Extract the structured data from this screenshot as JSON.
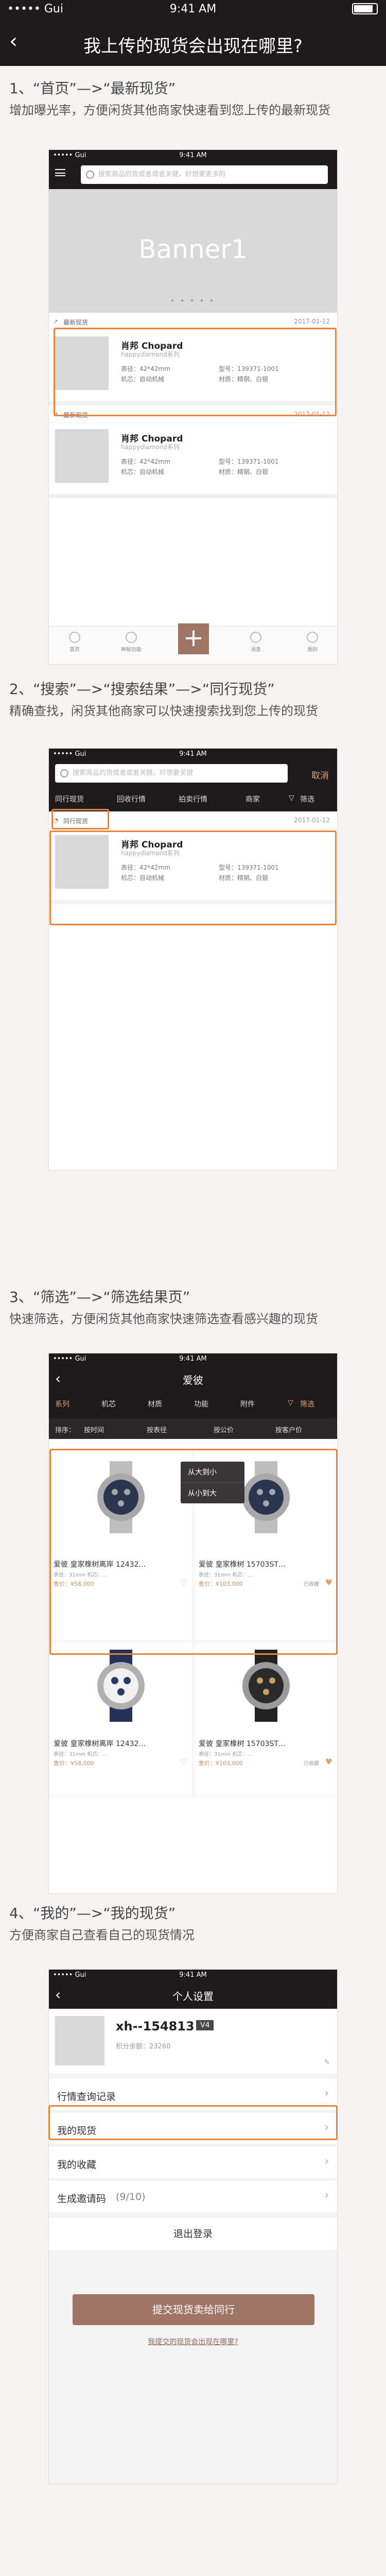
{
  "status_bar": {
    "carrier": "••••• Gui",
    "wifi": "wifi-icon",
    "time": "9:41 AM",
    "battery": "battery-icon"
  },
  "header": {
    "back": "‹",
    "title": "我上传的现货会出现在哪里?"
  },
  "sections": [
    {
      "title": "1、“首页”—>“最新现货”",
      "desc": "增加曝光率，方便闲货其他商家快速看到您上传的最新现货"
    },
    {
      "title": "2、“搜索”—>“搜索结果”—>“同行现货”",
      "desc": "精确查找，闲货其他商家可以快速搜索找到您上传的现货"
    },
    {
      "title": "3、“筛选”—>“筛选结果页”",
      "desc": "快速筛选，方便闲货其他商家快速筛选查看感兴趣的现货"
    },
    {
      "title": "4、“我的”—>“我的现货”",
      "desc": "方便商家自己查看自己的现货情况"
    }
  ],
  "mock_status": {
    "carrier": "••••• Gui",
    "time": "9:41 AM"
  },
  "home": {
    "search_placeholder": "搜索商品的货或者或者关键，好想要更多的",
    "banner": "Banner1",
    "dots": "• • • • •",
    "cards": [
      {
        "label": "最新现货",
        "date": "2017-01-12",
        "brand": "肖邦 Chopard",
        "series": "happydiamond系列",
        "spec1": "表径：42*42mm",
        "spec2": "型号：139371-1001",
        "spec3": "机芯：自动机械",
        "spec4": "材质：精钢、白银"
      },
      {
        "label": "最新现货",
        "date": "2017-01-12",
        "brand": "肖邦 Chopard",
        "series": "happydiamond系列",
        "spec1": "表径：42*42mm",
        "spec2": "型号：139371-1001",
        "spec3": "机芯：自动机械",
        "spec4": "材质：精钢、白银"
      }
    ],
    "tabs": [
      "首页",
      "神秘功能",
      "消息",
      "我的"
    ],
    "plus": "+"
  },
  "search": {
    "placeholder": "搜索商品的货或者或者关键，好想要关键",
    "cancel": "取消",
    "tabs": [
      "同行现货",
      "回收行情",
      "拍卖行情",
      "商家"
    ],
    "filter": "筛选",
    "card": {
      "label": "同行现货",
      "date": "2017-01-12",
      "brand": "肖邦 Chopard",
      "series": "happydiamond系列",
      "spec1": "表径：42*42mm",
      "spec2": "型号：139371-1001",
      "spec3": "机芯：自动机械",
      "spec4": "材质：精钢、白银"
    }
  },
  "filter": {
    "title": "爱彼",
    "tabs": [
      "系列",
      "机芯",
      "材质",
      "功能",
      "附件"
    ],
    "filter": "筛选",
    "sort_label": "排序：",
    "sorts": [
      "按时间",
      "按表径",
      "按公价",
      "按客户价"
    ],
    "dropdown": [
      "从大到小",
      "从小到大"
    ],
    "items": [
      {
        "name": "爱彼 皇家橡树离岸 12432…",
        "sub": "表径：31mm  机芯：...",
        "price": "售价：¥58,000",
        "tag": ""
      },
      {
        "name": "爱彼 皇家橡树 15703ST…",
        "sub": "表径：31mm  机芯：...",
        "price": "售价：¥103,000",
        "tag": "已收藏"
      },
      {
        "name": "爱彼 皇家橡树离岸 12432…",
        "sub": "表径：31mm  机芯：...",
        "price": "售价：¥58,000",
        "tag": ""
      },
      {
        "name": "爱彼 皇家橡树 15703ST…",
        "sub": "表径：31mm  机芯：...",
        "price": "售价：¥103,000",
        "tag": "已收藏"
      }
    ]
  },
  "mine": {
    "title": "个人设置",
    "username": "xh--154813",
    "level": "V4",
    "points": "积分余额：23260",
    "rows": [
      "行情查询记录",
      "我的现货",
      "我的收藏",
      "生成邀请码"
    ],
    "invite_count": "(9/10)",
    "logout": "退出登录",
    "submit": "提交现货卖给同行",
    "link": "我提交的现货会出现在哪里?"
  },
  "colors": {
    "dark": "#1c1a1b",
    "accent": "#e8833a",
    "brand": "#a07565",
    "bg": "#f5f3f1"
  }
}
